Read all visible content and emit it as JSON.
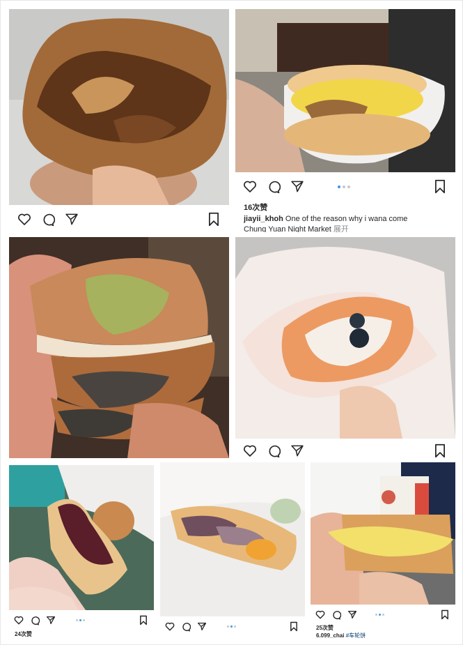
{
  "colors": {
    "active_dot": "#3897f0",
    "inactive_dot": "#c7c7c7",
    "icon": "#262626",
    "meta": "#8e8e8e"
  },
  "posts": [
    {
      "id": "p1",
      "food": "chocolate waffle cake",
      "icons": [
        "heart-icon",
        "comment-icon",
        "share-icon",
        "bookmark-icon"
      ]
    },
    {
      "id": "p2",
      "food": "cheese chicken waffle sandwich",
      "likes": "16次赞",
      "username": "jiayii_khoh",
      "caption_line1": "One of the reason why i wana come",
      "caption_line2": "Chung Yuan Night Market",
      "more": "展开",
      "dots": 3,
      "active_dot": 0
    },
    {
      "id": "p3",
      "food": "matcha and chocolate wheel cakes"
    },
    {
      "id": "p4",
      "food": "taro pearl wheel cake"
    },
    {
      "id": "p5",
      "food": "red bean wheel cake",
      "likes": "24次赞",
      "dots": 3,
      "active_dot": 1
    },
    {
      "id": "p6",
      "food": "taro egg yolk wheel cake",
      "dots": 3,
      "active_dot": 1
    },
    {
      "id": "p7",
      "food": "custard cream wheel cake",
      "likes": "25次赞",
      "username": "6.099_chai",
      "caption_tail": "#车轮饼",
      "dots": 3,
      "active_dot": 1
    }
  ]
}
